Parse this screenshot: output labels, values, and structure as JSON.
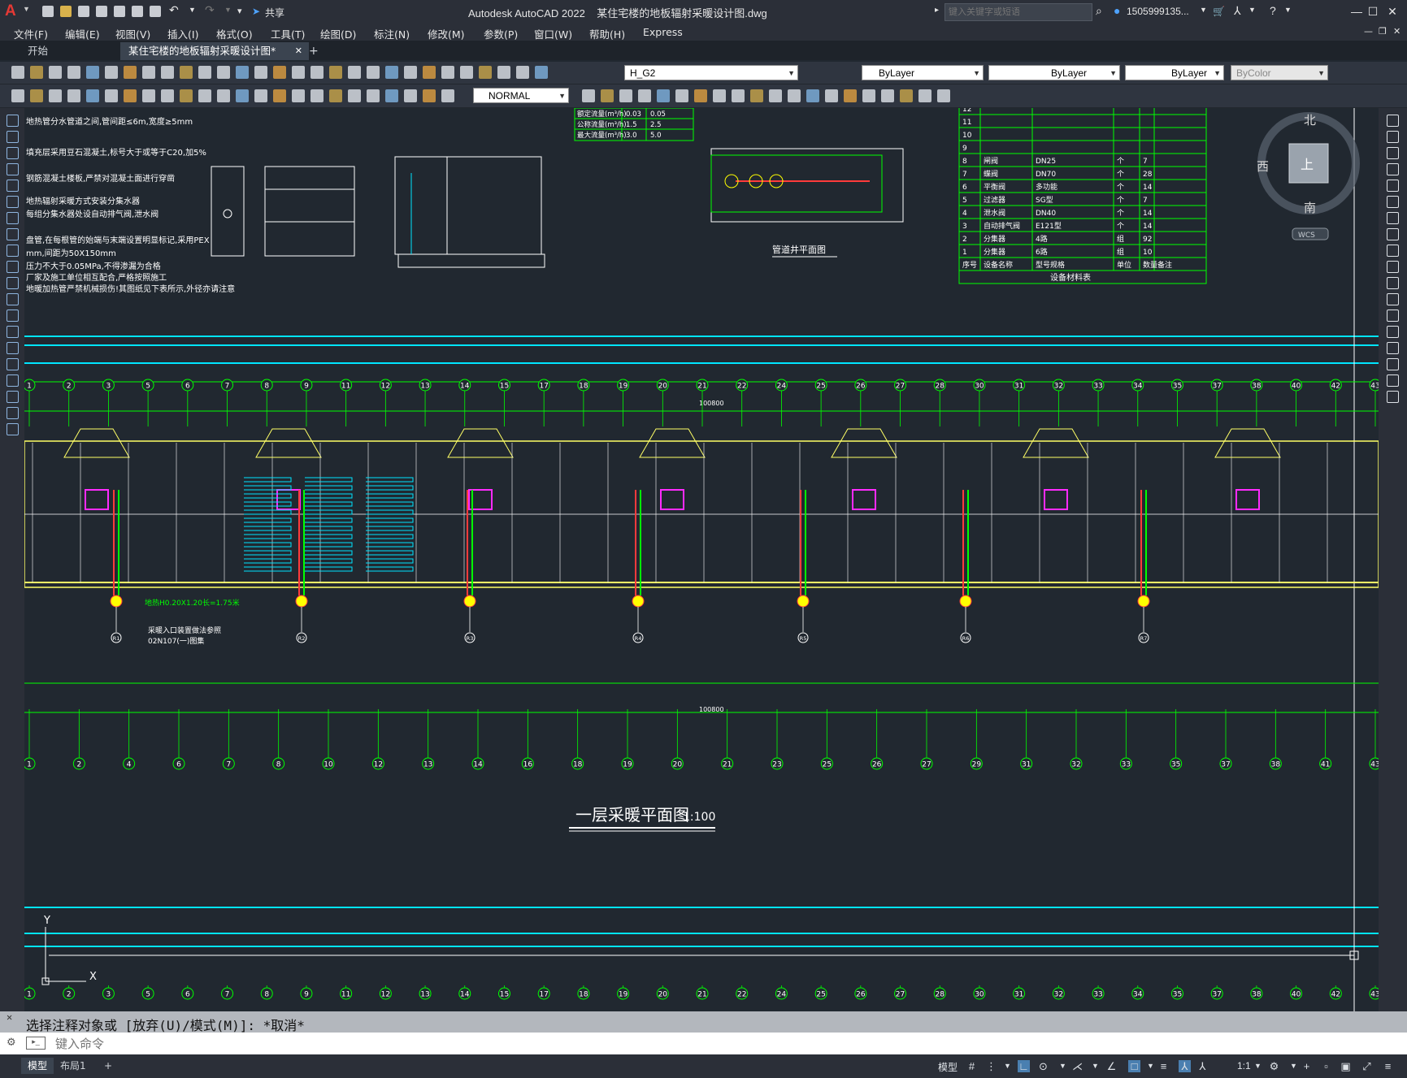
{
  "titlebar": {
    "app_title": "Autodesk AutoCAD 2022",
    "file_name": "某住宅楼的地板辐射采暖设计图.dwg",
    "share_label": "共享",
    "search_placeholder": "键入关键字或短语",
    "user_label": "1505999135...",
    "logo": "A"
  },
  "menu": [
    "文件(F)",
    "编辑(E)",
    "视图(V)",
    "插入(I)",
    "格式(O)",
    "工具(T)",
    "绘图(D)",
    "标注(N)",
    "修改(M)",
    "参数(P)",
    "窗口(W)",
    "帮助(H)",
    "Express"
  ],
  "tabs": {
    "start": "开始",
    "active": "某住宅楼的地板辐射采暖设计图*",
    "close": "✕",
    "add": "+"
  },
  "properties": {
    "layer": "H_G2",
    "color": "ByLayer",
    "linetype": "ByLayer",
    "lineweight": "ByLayer",
    "plotstyle": "ByColor",
    "dimstyle": "NORMAL"
  },
  "viewcube": {
    "north": "北",
    "south": "南",
    "west": "西",
    "top": "上",
    "wcs": "WCS"
  },
  "drawing": {
    "main_title": "一层采暖平面图",
    "scale": "1:100",
    "shaft_title": "管道井平面图",
    "table_title": "设备材料表",
    "table_headers": [
      "序号",
      "设备名称",
      "型号规格",
      "单位",
      "数量",
      "备注"
    ],
    "table_rows": [
      [
        "12",
        "",
        "",
        "",
        "",
        ""
      ],
      [
        "11",
        "",
        "",
        "",
        "",
        ""
      ],
      [
        "10",
        "",
        "",
        "",
        "",
        ""
      ],
      [
        "9",
        "",
        "",
        "",
        "",
        ""
      ],
      [
        "8",
        "闸阀",
        "DN25",
        "个",
        "7",
        ""
      ],
      [
        "7",
        "蝶阀",
        "DN70",
        "个",
        "28",
        ""
      ],
      [
        "6",
        "平衡阀",
        "多功能",
        "个",
        "14",
        ""
      ],
      [
        "5",
        "过滤器",
        "SG型",
        "个",
        "7",
        ""
      ],
      [
        "4",
        "泄水阀",
        "DN40",
        "个",
        "14",
        ""
      ],
      [
        "3",
        "自动排气阀",
        "E121型",
        "个",
        "14",
        ""
      ],
      [
        "2",
        "分集器",
        "4路",
        "组",
        "92",
        ""
      ],
      [
        "1",
        "分集器",
        "6路",
        "组",
        "10",
        ""
      ]
    ],
    "flow_table": [
      [
        "额定流量(m³/h)",
        "0.03",
        "0.05"
      ],
      [
        "公称流量(m³/h)",
        "1.5",
        "2.5"
      ],
      [
        "最大流量(m³/h)",
        "3.0",
        "5.0"
      ]
    ],
    "grid_top": [
      "1",
      "2",
      "3",
      "5",
      "6",
      "7",
      "8",
      "9",
      "11",
      "12",
      "13",
      "14",
      "15",
      "17",
      "18",
      "19",
      "20",
      "21",
      "22",
      "24",
      "25",
      "26",
      "27",
      "28",
      "30",
      "31",
      "32",
      "33",
      "34",
      "35",
      "37",
      "38",
      "40",
      "42",
      "43"
    ],
    "grid_bottom": [
      "1",
      "2",
      "4",
      "6",
      "7",
      "8",
      "10",
      "12",
      "13",
      "14",
      "16",
      "18",
      "19",
      "20",
      "21",
      "23",
      "25",
      "26",
      "27",
      "29",
      "31",
      "32",
      "33",
      "35",
      "37",
      "38",
      "41",
      "43"
    ],
    "riser_labels": [
      "R1",
      "R2",
      "R3",
      "R4",
      "R5",
      "R6",
      "R7"
    ],
    "total_dim": "100800",
    "total_dim_bottom": "100800",
    "notes": [
      "地热管分水管道之间,管间距≤6m,宽度≥5mm",
      "填充层采用豆石混凝土,标号大于或等于C20,加5%",
      "钢筋混凝土楼板,严禁对混凝土面进行穿凿",
      "地热辐射采暖方式安装分集水器",
      "每组分集水器处设自动排气阀,泄水阀",
      "盘管,在每根管的始端与末端设置明显标记,采用PEX",
      "mm,间距为50X150mm",
      "压力不大于0.05MPa,不得渗漏为合格",
      "厂家及施工单位相互配合,严格按照施工",
      "地暖加热管严禁机械损伤!其图纸见下表所示,外径亦请注意"
    ],
    "annot_1": "地热H0.20X1.20长=1.75米",
    "annot_2": "采暖入口装置做法参照",
    "annot_3": "02N107(一)图集"
  },
  "command": {
    "history": "选择注释对象或 [放弃(U)/模式(M)]: *取消*",
    "placeholder": "键入命令"
  },
  "status": {
    "model_tab": "模型",
    "layout_tab": "布局1",
    "add_tab": "+",
    "model_label": "模型",
    "scale": "1:1"
  }
}
